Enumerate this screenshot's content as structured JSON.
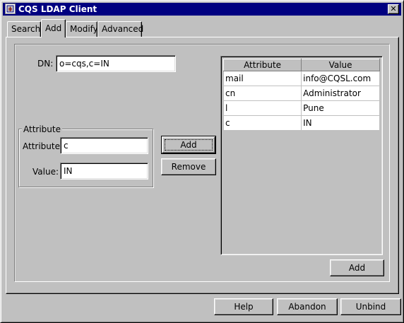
{
  "window": {
    "title": "CQS LDAP Client",
    "close_label": "✕"
  },
  "tabs": [
    {
      "label": "Search",
      "active": false
    },
    {
      "label": "Add",
      "active": true
    },
    {
      "label": "Modify",
      "active": false
    },
    {
      "label": "Advanced",
      "active": false
    }
  ],
  "form": {
    "dn_label": "DN:",
    "dn_value": "o=cqs,c=IN",
    "group_title": "Attribute",
    "attribute_label": "Attribute:",
    "attribute_value": "c",
    "value_label": "Value:",
    "value_value": "IN",
    "add_label": "Add",
    "remove_label": "Remove"
  },
  "table": {
    "headers": [
      "Attribute",
      "Value"
    ],
    "rows": [
      [
        "mail",
        "info@CQSL.com"
      ],
      [
        "cn",
        "Administrator"
      ],
      [
        "l",
        "Pune"
      ],
      [
        "c",
        "IN"
      ]
    ],
    "add_label": "Add"
  },
  "footer": {
    "help_label": "Help",
    "abandon_label": "Abandon",
    "unbind_label": "Unbind"
  },
  "icons": {
    "app": "app-icon",
    "close": "close-icon"
  }
}
